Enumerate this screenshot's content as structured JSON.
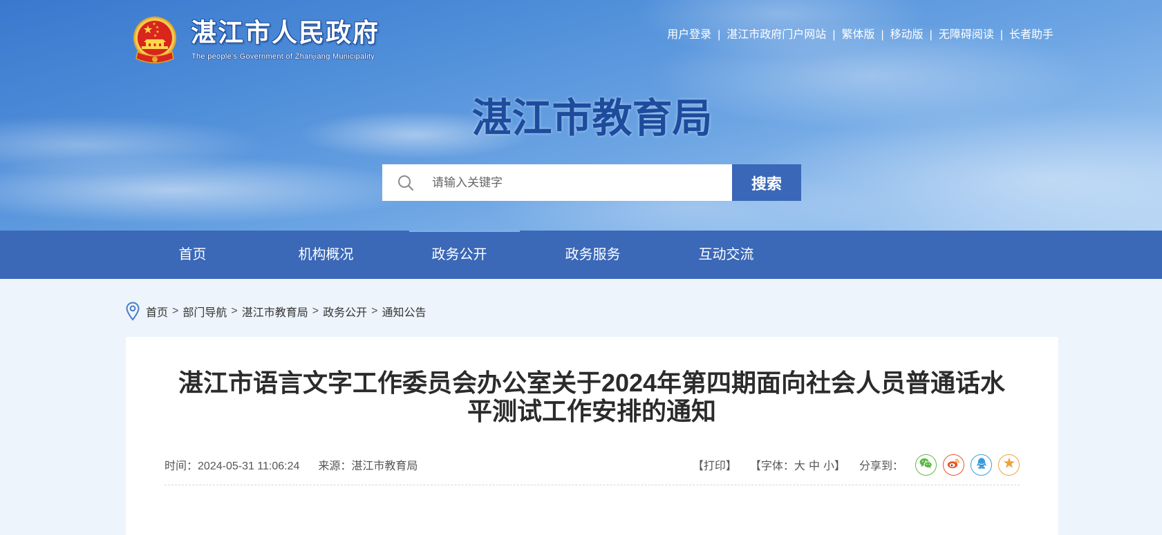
{
  "header": {
    "gov_name": "湛江市人民政府",
    "gov_name_en": "The people's Government of Zhanjiang Municipality",
    "top_links": [
      "用户登录",
      "湛江市政府门户网站",
      "繁体版",
      "移动版",
      "无障碍阅读",
      "长者助手"
    ],
    "top_links_separator": "|",
    "site_title": "湛江市教育局",
    "search": {
      "placeholder": "请输入关键字",
      "button_label": "搜索",
      "icon": "search-icon"
    },
    "emblem_icon": "national-emblem-icon"
  },
  "nav": {
    "items": [
      "首页",
      "机构概况",
      "政务公开",
      "政务服务",
      "互动交流"
    ],
    "active": "政务公开"
  },
  "breadcrumb": {
    "icon": "location-pin-icon",
    "items": [
      "首页",
      "部门导航",
      "湛江市教育局",
      "政务公开",
      "通知公告"
    ],
    "separator": ">"
  },
  "article": {
    "title": "湛江市语言文字工作委员会办公室关于2024年第四期面向社会人员普通话水平测试工作安排的通知",
    "time_label": "时间：",
    "time": "2024-05-31 11:06:24",
    "source_label": "来源：",
    "source": "湛江市教育局",
    "print_label": "【打印】",
    "font_label_open": "【字体：",
    "font_sizes": [
      "大",
      "中",
      "小"
    ],
    "font_label_close": "】",
    "share_label": "分享到：",
    "share_icons": [
      "wechat-icon",
      "weibo-icon",
      "qq-icon",
      "star-icon"
    ]
  },
  "colors": {
    "nav_bg": "#3B68B7",
    "site_title": "#1D4C9D",
    "search_button": "#3A67B7",
    "page_bg": "#EDF4FB"
  }
}
